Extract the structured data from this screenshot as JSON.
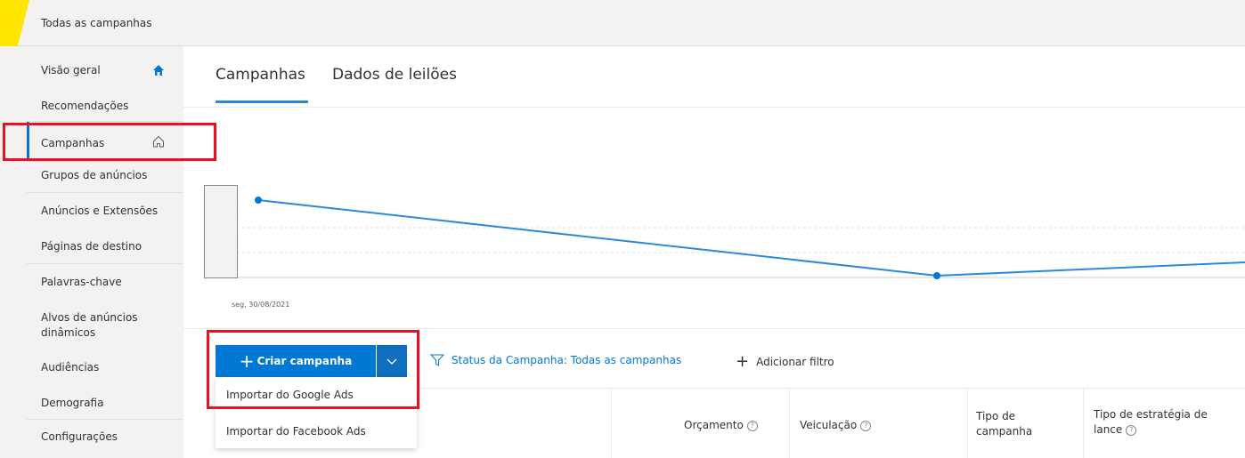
{
  "topbar": {
    "title": "Todas as campanhas"
  },
  "sidebar": {
    "items": [
      {
        "label": "Visão geral"
      },
      {
        "label": "Recomendações"
      },
      {
        "label": "Campanhas"
      },
      {
        "label": "Grupos de anúncios"
      },
      {
        "label": "Anúncios e Extensões"
      },
      {
        "label": "Páginas de destino"
      },
      {
        "label": "Palavras-chave"
      },
      {
        "label": "Alvos de anúncios dinâmicos"
      },
      {
        "label": "Audiências"
      },
      {
        "label": "Demografia"
      },
      {
        "label": "Configurações"
      }
    ]
  },
  "tabs": [
    {
      "label": "Campanhas"
    },
    {
      "label": "Dados de leilões"
    }
  ],
  "chart": {
    "date_label": "seg, 30/08/2021"
  },
  "toolbar": {
    "create_label": "Criar campanha",
    "status_filter": "Status da Campanha: Todas as campanhas",
    "add_filter": "Adicionar filtro"
  },
  "dropdown": {
    "items": [
      {
        "label": "Importar do Google Ads"
      },
      {
        "label": "Importar do Facebook Ads"
      }
    ]
  },
  "table": {
    "headers": [
      {
        "label": "Orçamento"
      },
      {
        "label": "Veiculação"
      },
      {
        "label": "Tipo de campanha"
      },
      {
        "label": "Tipo de estratégia de lance"
      }
    ]
  },
  "colors": {
    "accent": "#0078d4",
    "highlight": "#e81123",
    "marker": "#ffe600"
  }
}
